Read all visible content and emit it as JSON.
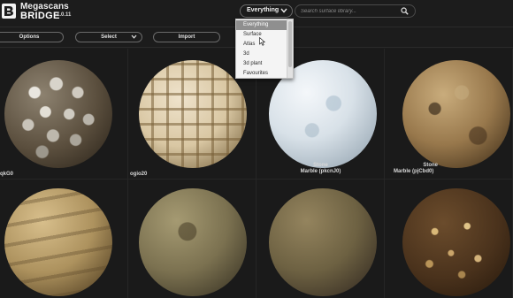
{
  "app": {
    "logo_top": "Megascans",
    "logo_bottom": "BRIDGE",
    "version": "1.0.11"
  },
  "filter": {
    "selected": "Everything",
    "options": [
      "Everything",
      "Surface",
      "Atlas",
      "3d",
      "3d plant",
      "Favourites"
    ]
  },
  "search": {
    "placeholder": "Search surface library..."
  },
  "toolbar": {
    "options_label": "Options",
    "select_label": "Select",
    "import_label": "Import"
  },
  "assets": [
    {
      "line1": "",
      "line2": "qkG0"
    },
    {
      "line1": "",
      "line2": "ogio20"
    },
    {
      "line1": "Stone",
      "line2": "Marble (pkcnJ0)"
    },
    {
      "line1": "Stone",
      "line2": "Marble (pjCbd0)"
    },
    {
      "line1": "",
      "line2": ""
    },
    {
      "line1": "",
      "line2": ""
    },
    {
      "line1": "",
      "line2": ""
    },
    {
      "line1": "",
      "line2": ""
    }
  ],
  "colors": {
    "background": "#1c1c1c",
    "menu_selected": "#8f8f8f"
  },
  "icons": [
    "logo-mark-icon",
    "chevron-down-icon",
    "search-icon",
    "mouse-cursor-icon"
  ]
}
